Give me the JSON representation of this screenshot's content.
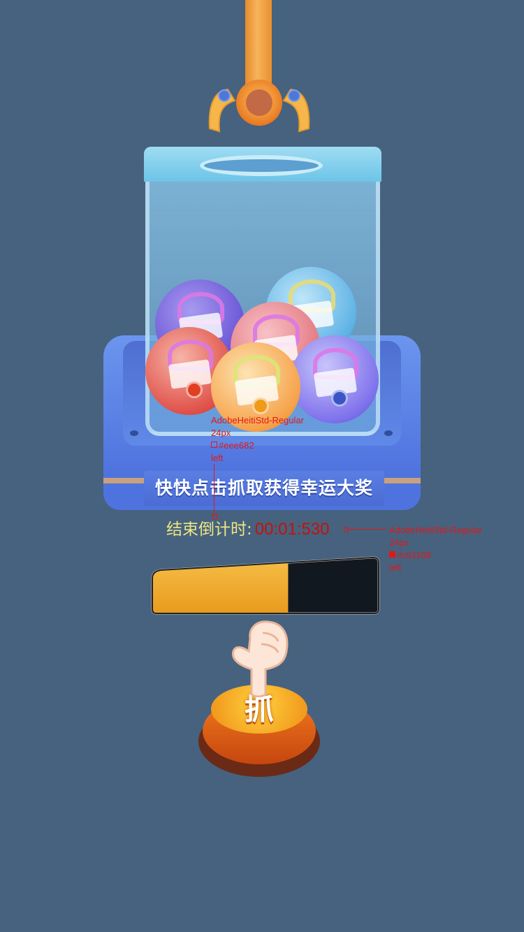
{
  "machine": {
    "slogan": "快快点击抓取获得幸运大奖",
    "ball_count": 6
  },
  "countdown": {
    "label": "结束倒计时:",
    "time": "00:01:530",
    "label_color": "#eee682",
    "time_color": "#c61108"
  },
  "progress": {
    "fill_fraction": 0.6,
    "fill_color": "#f2a929",
    "track_color": "#121820"
  },
  "button": {
    "label": "抓"
  },
  "annotations": {
    "label_spec": {
      "font": "AdobeHeitiStd-Regular",
      "size": "24px",
      "color": "#eee682",
      "align": "left"
    },
    "time_spec": {
      "font": "AdobeHeitiStd-Regular",
      "size": "24px",
      "color": "#c61108",
      "align": "left"
    }
  },
  "colors": {
    "background": "#46627f",
    "accent_orange": "#f29b1e",
    "machine_blue": "#5a7ee2"
  }
}
